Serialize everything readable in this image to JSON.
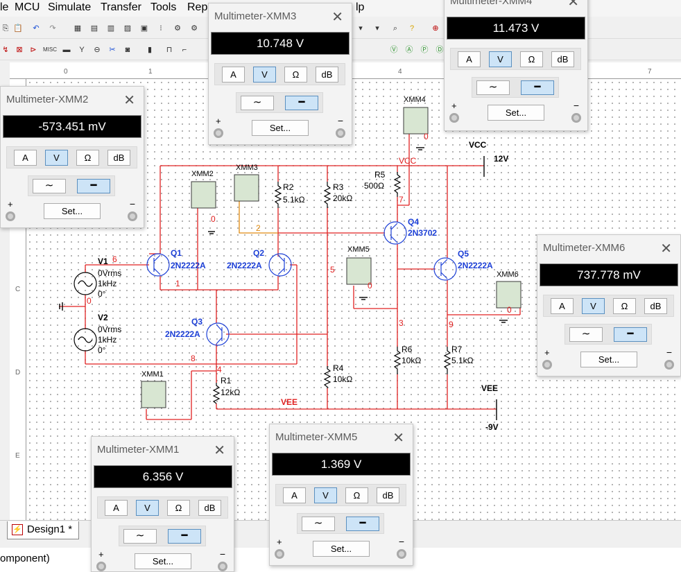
{
  "menu": [
    "le",
    "MCU",
    "Simulate",
    "Transfer",
    "Tools",
    "Repo",
    "lp"
  ],
  "ruler": {
    "h": [
      "0",
      "1",
      "4",
      "7"
    ],
    "v": [
      "C",
      "D",
      "E"
    ]
  },
  "schematic": {
    "labels": {
      "xmm1": "XMM1",
      "xmm2": "XMM2",
      "xmm3": "XMM3",
      "xmm4": "XMM4",
      "xmm5": "XMM5",
      "xmm6": "XMM6",
      "q1": "Q1",
      "q1_model": "2N2222A",
      "q2": "Q2",
      "q2_model": "2N2222A",
      "q3": "Q3",
      "q3_model": "2N2222A",
      "q4": "Q4",
      "q4_model": "2N3702",
      "q5": "Q5",
      "q5_model": "2N2222A",
      "r1": "R1",
      "r1_val": "12kΩ",
      "r2": "R2",
      "r2_val": "5.1kΩ",
      "r3": "R3",
      "r3_val": "20kΩ",
      "r4": "R4",
      "r4_val": "10kΩ",
      "r5": "R5",
      "r5_val": "500Ω",
      "r6": "R6",
      "r6_val": "10kΩ",
      "r7": "R7",
      "r7_val": "5.1kΩ",
      "v1": "V1",
      "v1_a": "0Vrms",
      "v1_b": "1kHz",
      "v1_c": "0°",
      "v2": "V2",
      "v2_a": "0Vrms",
      "v2_b": "1kHz",
      "v2_c": "0°",
      "vcc": "VCC",
      "vcc_val": "12V",
      "vcc_net": "VCC",
      "vee": "VEE",
      "vee_val": "-9V",
      "vee_net": "VEE"
    },
    "nets": {
      "n6": "6",
      "n0a": "0",
      "n1": "1",
      "n8": "8",
      "n4": "4",
      "n5": "5",
      "n3": "3",
      "n9": "9",
      "n7": "7",
      "n2": "2",
      "n0b": "0",
      "n0c": "0",
      "n0d": "0",
      "n0e": "0"
    }
  },
  "tab": {
    "label": "Design1 *"
  },
  "output": {
    "text": "omponent)"
  },
  "multimeters": [
    {
      "title": "Multimeter-XMM2",
      "value": "-573.451 mV",
      "buttons": [
        "A",
        "V",
        "Ω",
        "dB"
      ],
      "selected": "V",
      "set": "Set..."
    },
    {
      "title": "Multimeter-XMM3",
      "value": "10.748 V",
      "buttons": [
        "A",
        "V",
        "Ω",
        "dB"
      ],
      "selected": "V",
      "set": "Set..."
    },
    {
      "title": "Multimeter-XMM4",
      "value": "11.473 V",
      "buttons": [
        "A",
        "V",
        "Ω",
        "dB"
      ],
      "selected": "V",
      "set": "Set..."
    },
    {
      "title": "Multimeter-XMM6",
      "value": "737.778 mV",
      "buttons": [
        "A",
        "V",
        "Ω",
        "dB"
      ],
      "selected": "V",
      "set": "Set..."
    },
    {
      "title": "Multimeter-XMM1",
      "value": "6.356 V",
      "buttons": [
        "A",
        "V",
        "Ω",
        "dB"
      ],
      "selected": "V",
      "set": "Set..."
    },
    {
      "title": "Multimeter-XMM5",
      "value": "1.369 V",
      "buttons": [
        "A",
        "V",
        "Ω",
        "dB"
      ],
      "selected": "V",
      "set": "Set..."
    }
  ],
  "colors": {
    "wire": "#e02020",
    "component": "#1c3fd6",
    "probe_wire": "#e08a10",
    "canvas": "#ffffff",
    "display": "#000000"
  }
}
